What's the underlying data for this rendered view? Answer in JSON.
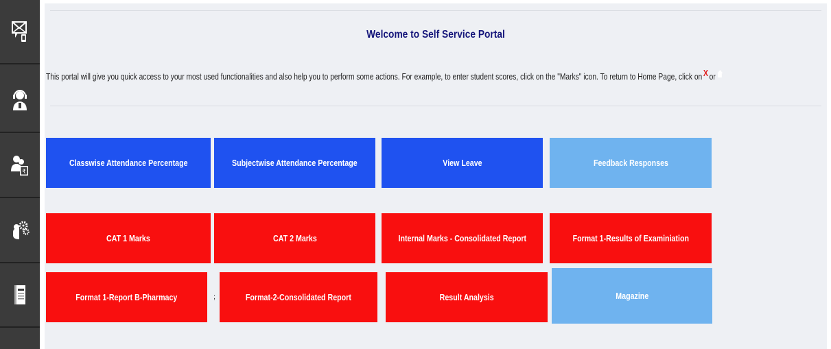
{
  "sidebar": {
    "items": [
      {
        "icon": "message-mobile-icon"
      },
      {
        "icon": "support-headset-icon"
      },
      {
        "icon": "user-payment-icon"
      },
      {
        "icon": "settings-gears-icon"
      },
      {
        "icon": "notebook-icon"
      }
    ]
  },
  "header": {
    "title": "Welcome to Self Service Portal",
    "description": "This portal will give you quick access to your most used functionalities and also help you to perform some actions. For example, to enter student scores, click on the \"Marks\" icon. To return to Home Page, click on",
    "close_glyph": "X",
    "or_text": "or"
  },
  "colors": {
    "sidebar_bg": "#3b3b3b",
    "primary_blue": "#1f52f0",
    "light_blue": "#6fb3ef",
    "red": "#f90f0f",
    "title_color": "#14157a"
  },
  "tiles": {
    "row1": [
      {
        "label": "Classwise Attendance Percentage"
      },
      {
        "label": "Subjectwise Attendance Percentage"
      },
      {
        "label": "View Leave"
      },
      {
        "label": "Feedback Responses"
      }
    ],
    "row2": [
      {
        "label": "CAT 1 Marks"
      },
      {
        "label": "CAT 2 Marks"
      },
      {
        "label": "Internal Marks - Consolidated Report"
      },
      {
        "label": "Format 1-Results of Examiniation"
      }
    ],
    "row3": [
      {
        "label": "Format 1-Report B-Pharmacy"
      },
      {
        "label": "Format-2-Consolidated Report"
      },
      {
        "label": "Result Analysis"
      },
      {
        "label": "Magazine"
      }
    ],
    "separator": ";"
  }
}
